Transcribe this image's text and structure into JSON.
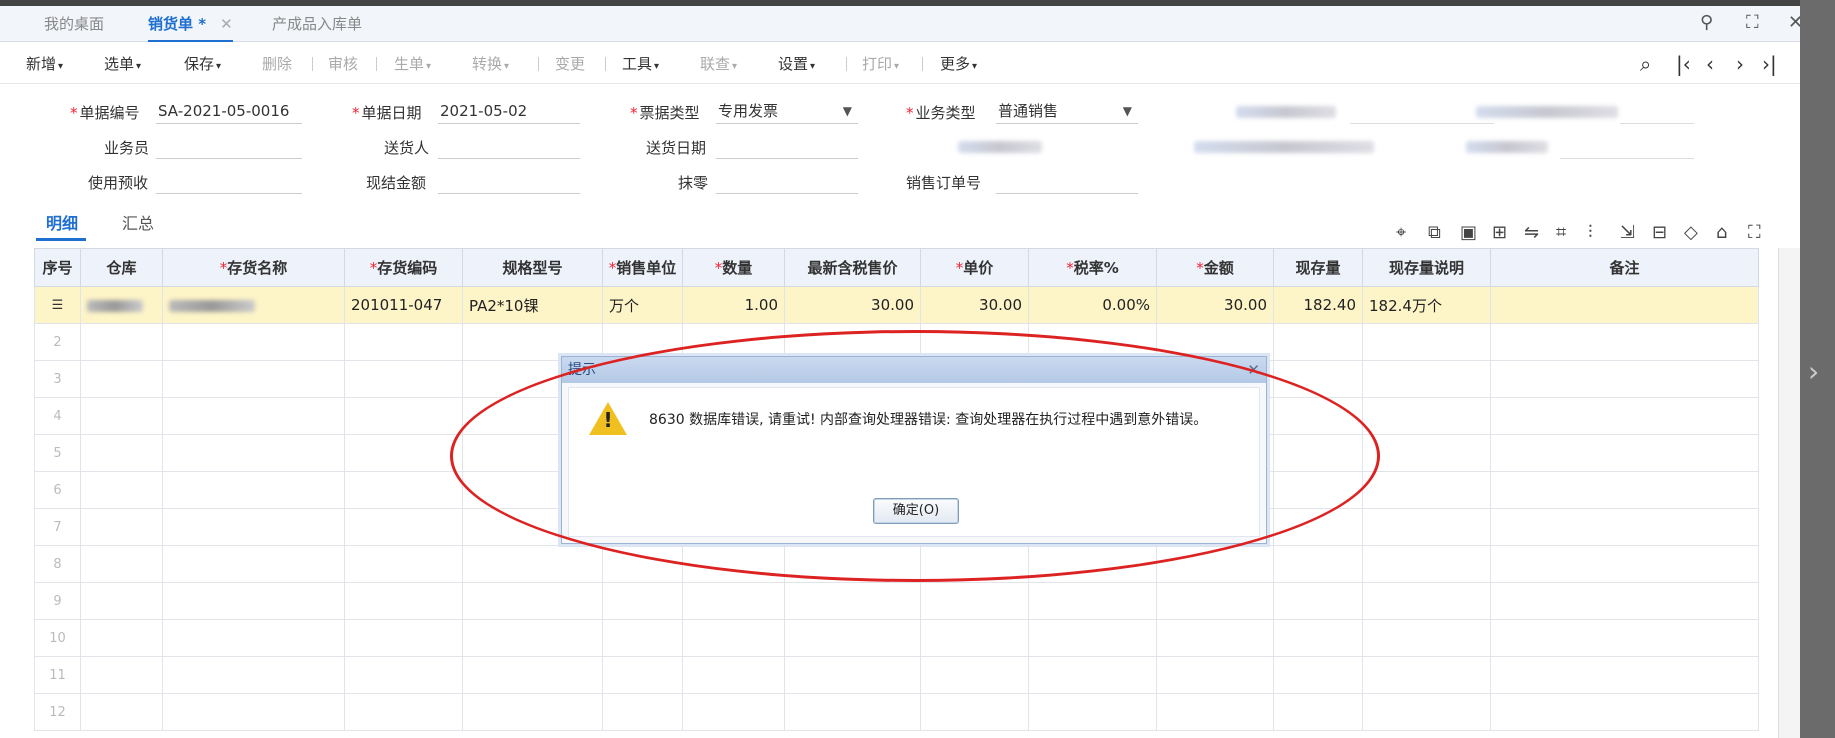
{
  "tabs": [
    {
      "label": "我的桌面",
      "active": false
    },
    {
      "label": "销货单 *",
      "active": true,
      "closable": true
    },
    {
      "label": "产成品入库单",
      "active": false
    }
  ],
  "toolbar": {
    "items": [
      {
        "label": "新增",
        "caret": true,
        "disabled": false
      },
      {
        "label": "选单",
        "caret": true,
        "disabled": false
      },
      {
        "label": "保存",
        "caret": true,
        "disabled": false
      },
      {
        "label": "删除",
        "caret": false,
        "disabled": true
      },
      {
        "label": "审核",
        "caret": false,
        "disabled": true
      },
      {
        "label": "生单",
        "caret": true,
        "disabled": true
      },
      {
        "label": "转换",
        "caret": true,
        "disabled": true
      },
      {
        "label": "变更",
        "caret": false,
        "disabled": true
      },
      {
        "label": "工具",
        "caret": true,
        "disabled": false
      },
      {
        "label": "联查",
        "caret": true,
        "disabled": true
      },
      {
        "label": "设置",
        "caret": true,
        "disabled": false
      },
      {
        "label": "打印",
        "caret": true,
        "disabled": true
      },
      {
        "label": "更多",
        "caret": true,
        "disabled": false
      }
    ]
  },
  "form": {
    "doc_no_label": "单据编号",
    "doc_no": "SA-2021-05-0016",
    "doc_date_label": "单据日期",
    "doc_date": "2021-05-02",
    "invoice_type_label": "票据类型",
    "invoice_type": "专用发票",
    "biz_type_label": "业务类型",
    "biz_type": "普通销售",
    "salesman_label": "业务员",
    "salesman": "",
    "deliverer_label": "送货人",
    "deliverer": "",
    "delivery_date_label": "送货日期",
    "delivery_date": "",
    "prepay_label": "使用预收",
    "prepay": "",
    "cash_label": "现结金额",
    "cash": "",
    "rounding_label": "抹零",
    "rounding": "",
    "so_no_label": "销售订单号",
    "so_no": ""
  },
  "subtabs": [
    "明细",
    "汇总"
  ],
  "grid": {
    "columns": [
      {
        "label": "序号",
        "req": false
      },
      {
        "label": "仓库",
        "req": false
      },
      {
        "label": "存货名称",
        "req": true
      },
      {
        "label": "存货编码",
        "req": true
      },
      {
        "label": "规格型号",
        "req": false
      },
      {
        "label": "销售单位",
        "req": true
      },
      {
        "label": "数量",
        "req": true
      },
      {
        "label": "最新含税售价",
        "req": false
      },
      {
        "label": "单价",
        "req": true
      },
      {
        "label": "税率%",
        "req": true
      },
      {
        "label": "金额",
        "req": true
      },
      {
        "label": "现存量",
        "req": false
      },
      {
        "label": "现存量说明",
        "req": false
      },
      {
        "label": "备注",
        "req": false
      }
    ],
    "row1": {
      "code": "201011-047",
      "spec": "PA2*10锞",
      "unit": "万个",
      "qty": "1.00",
      "latest_price": "30.00",
      "unit_price": "30.00",
      "tax_rate": "0.00%",
      "amount": "30.00",
      "stock": "182.40",
      "stock_desc": "182.4万个",
      "remark": ""
    },
    "empty_rows": [
      "2",
      "3",
      "4",
      "5",
      "6",
      "7",
      "8",
      "9",
      "10",
      "11",
      "12"
    ]
  },
  "dialog": {
    "title": "提示",
    "message": "8630 数据库错误, 请重试! 内部查询处理器错误: 查询处理器在执行过程中遇到意外错误。",
    "ok_label": "确定(O)"
  },
  "colors": {
    "accent": "#1f6fd1",
    "required": "#e23333",
    "selected_row": "#fdf4c8",
    "annotation": "#dd2222"
  }
}
